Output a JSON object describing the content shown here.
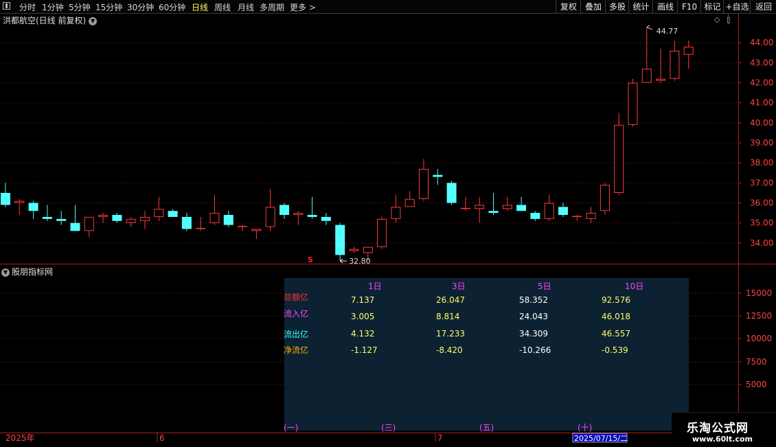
{
  "toolbar": {
    "periods": [
      "分时",
      "1分钟",
      "5分钟",
      "15分钟",
      "30分钟",
      "60分钟",
      "日线",
      "周线",
      "月线",
      "多周期",
      "更多 >"
    ],
    "active_period": "日线",
    "right_buttons": [
      "复权",
      "叠加",
      "多股",
      "统计",
      "画线",
      "F10",
      "标记",
      "+自选",
      "返回"
    ]
  },
  "stock_title": "洪都航空(日线 前复权)",
  "indicator_title": "股朋指标网",
  "price_axis_labels": [
    "44.00",
    "43.00",
    "42.00",
    "41.00",
    "40.00",
    "39.00",
    "38.00",
    "37.00",
    "36.00",
    "35.00",
    "34.00"
  ],
  "volume_axis_labels": [
    "15000",
    "12500",
    "10000",
    "7500",
    "5000"
  ],
  "high_label": "44.77",
  "low_label": "32.80",
  "signal_marker": "S",
  "time_axis": {
    "labels": [
      "2025年",
      "6",
      "7"
    ],
    "cursor_date": "2025/07/15/二"
  },
  "fund_table": {
    "headers": [
      "1日",
      "3日",
      "5日",
      "10日"
    ],
    "rows": [
      {
        "label": "总额亿",
        "label_color": "#ff3333",
        "values": [
          "7.137",
          "26.047",
          "58.352",
          "92.576"
        ]
      },
      {
        "label": "流入亿",
        "label_color": "#ff44ff",
        "values": [
          "3.005",
          "8.814",
          "24.043",
          "46.018"
        ]
      },
      {
        "label": "流出亿",
        "label_color": "#33ffff",
        "values": [
          "4.132",
          "17.233",
          "34.309",
          "46.557"
        ]
      },
      {
        "label": "净流亿",
        "label_color": "#ffaa00",
        "values": [
          "-1.127",
          "-8.420",
          "-10.266",
          "-0.539"
        ]
      }
    ],
    "period_markers": [
      "(一)",
      "(三)",
      "(五)",
      "(十)"
    ]
  },
  "watermark": {
    "name": "乐淘公式网",
    "url": "www.60lt.com"
  },
  "colors": {
    "up": "#ff3b3b",
    "down": "#54ffff",
    "grid": "#8b1a1a",
    "bar_total": "#a00b0b",
    "bar_in": "#ff00ff",
    "bar_out": "#00ffff"
  },
  "chart_data": {
    "type": "candlestick",
    "y_range": [
      33.0,
      44.9
    ],
    "volume_axis_range": [
      2500,
      17500
    ],
    "candles": [
      {
        "o": 36.5,
        "h": 37.0,
        "l": 35.8,
        "c": 35.9
      },
      {
        "o": 36.0,
        "h": 36.2,
        "l": 35.4,
        "c": 36.1
      },
      {
        "o": 36.0,
        "h": 36.1,
        "l": 35.2,
        "c": 35.6
      },
      {
        "o": 35.3,
        "h": 35.9,
        "l": 35.1,
        "c": 35.2
      },
      {
        "o": 35.2,
        "h": 35.6,
        "l": 34.9,
        "c": 35.1
      },
      {
        "o": 35.0,
        "h": 35.9,
        "l": 34.8,
        "c": 34.6
      },
      {
        "o": 34.6,
        "h": 35.3,
        "l": 34.3,
        "c": 35.3
      },
      {
        "o": 35.3,
        "h": 35.5,
        "l": 35.0,
        "c": 35.4
      },
      {
        "o": 35.4,
        "h": 35.5,
        "l": 35.0,
        "c": 35.1
      },
      {
        "o": 35.0,
        "h": 35.3,
        "l": 34.8,
        "c": 35.2
      },
      {
        "o": 35.1,
        "h": 35.6,
        "l": 34.7,
        "c": 35.3
      },
      {
        "o": 35.3,
        "h": 36.3,
        "l": 35.1,
        "c": 35.7
      },
      {
        "o": 35.6,
        "h": 35.7,
        "l": 35.3,
        "c": 35.3
      },
      {
        "o": 35.3,
        "h": 35.5,
        "l": 34.6,
        "c": 34.7
      },
      {
        "o": 34.7,
        "h": 35.3,
        "l": 34.6,
        "c": 34.75
      },
      {
        "o": 35.0,
        "h": 36.4,
        "l": 34.9,
        "c": 35.5
      },
      {
        "o": 35.4,
        "h": 35.6,
        "l": 34.8,
        "c": 34.9
      },
      {
        "o": 34.8,
        "h": 34.9,
        "l": 34.6,
        "c": 34.85
      },
      {
        "o": 34.6,
        "h": 34.7,
        "l": 34.2,
        "c": 34.7
      },
      {
        "o": 34.8,
        "h": 36.7,
        "l": 34.6,
        "c": 35.8
      },
      {
        "o": 35.9,
        "h": 36.0,
        "l": 35.2,
        "c": 35.4
      },
      {
        "o": 35.4,
        "h": 35.6,
        "l": 34.9,
        "c": 35.5
      },
      {
        "o": 35.4,
        "h": 36.3,
        "l": 35.2,
        "c": 35.3
      },
      {
        "o": 35.3,
        "h": 35.5,
        "l": 34.9,
        "c": 35.1
      },
      {
        "o": 34.9,
        "h": 35.0,
        "l": 33.1,
        "c": 33.4
      },
      {
        "o": 33.6,
        "h": 33.8,
        "l": 33.5,
        "c": 33.7
      },
      {
        "o": 33.5,
        "h": 33.8,
        "l": 33.1,
        "c": 33.8
      },
      {
        "o": 33.8,
        "h": 35.3,
        "l": 33.7,
        "c": 35.2
      },
      {
        "o": 35.2,
        "h": 36.4,
        "l": 35.0,
        "c": 35.8
      },
      {
        "o": 35.8,
        "h": 36.6,
        "l": 35.8,
        "c": 36.2
      },
      {
        "o": 36.2,
        "h": 38.2,
        "l": 36.1,
        "c": 37.7
      },
      {
        "o": 37.4,
        "h": 37.7,
        "l": 36.9,
        "c": 37.3
      },
      {
        "o": 37.0,
        "h": 37.1,
        "l": 35.9,
        "c": 36.0
      },
      {
        "o": 35.7,
        "h": 36.3,
        "l": 35.6,
        "c": 35.75
      },
      {
        "o": 35.7,
        "h": 36.3,
        "l": 35.0,
        "c": 35.9
      },
      {
        "o": 35.6,
        "h": 36.5,
        "l": 35.4,
        "c": 35.5
      },
      {
        "o": 35.7,
        "h": 36.3,
        "l": 35.6,
        "c": 35.9
      },
      {
        "o": 35.9,
        "h": 36.3,
        "l": 35.8,
        "c": 35.6
      },
      {
        "o": 35.5,
        "h": 35.6,
        "l": 35.1,
        "c": 35.2
      },
      {
        "o": 35.2,
        "h": 36.4,
        "l": 35.1,
        "c": 36.0
      },
      {
        "o": 35.8,
        "h": 36.0,
        "l": 35.3,
        "c": 35.4
      },
      {
        "o": 35.3,
        "h": 35.4,
        "l": 35.1,
        "c": 35.35
      },
      {
        "o": 35.2,
        "h": 35.8,
        "l": 35.0,
        "c": 35.5
      },
      {
        "o": 35.6,
        "h": 37.0,
        "l": 35.4,
        "c": 36.9
      },
      {
        "o": 36.5,
        "h": 40.5,
        "l": 36.4,
        "c": 39.9
      },
      {
        "o": 39.9,
        "h": 42.2,
        "l": 39.8,
        "c": 42.0
      },
      {
        "o": 42.0,
        "h": 44.77,
        "l": 42.0,
        "c": 42.7
      },
      {
        "o": 42.1,
        "h": 43.7,
        "l": 42.0,
        "c": 42.2
      },
      {
        "o": 42.2,
        "h": 44.1,
        "l": 42.1,
        "c": 43.6
      },
      {
        "o": 43.4,
        "h": 44.1,
        "l": 42.7,
        "c": 43.8
      }
    ],
    "fund_bars": [
      {
        "period": "1日",
        "total": 7.137,
        "inflow": 3.005,
        "outflow": 4.132
      },
      {
        "period": "3日",
        "total": 26.047,
        "inflow": 8.814,
        "outflow": 17.233
      },
      {
        "period": "5日",
        "total": 58.352,
        "inflow": 24.043,
        "outflow": 34.309
      },
      {
        "period": "10日",
        "total": 92.576,
        "inflow": 46.018,
        "outflow": 46.557
      }
    ]
  }
}
